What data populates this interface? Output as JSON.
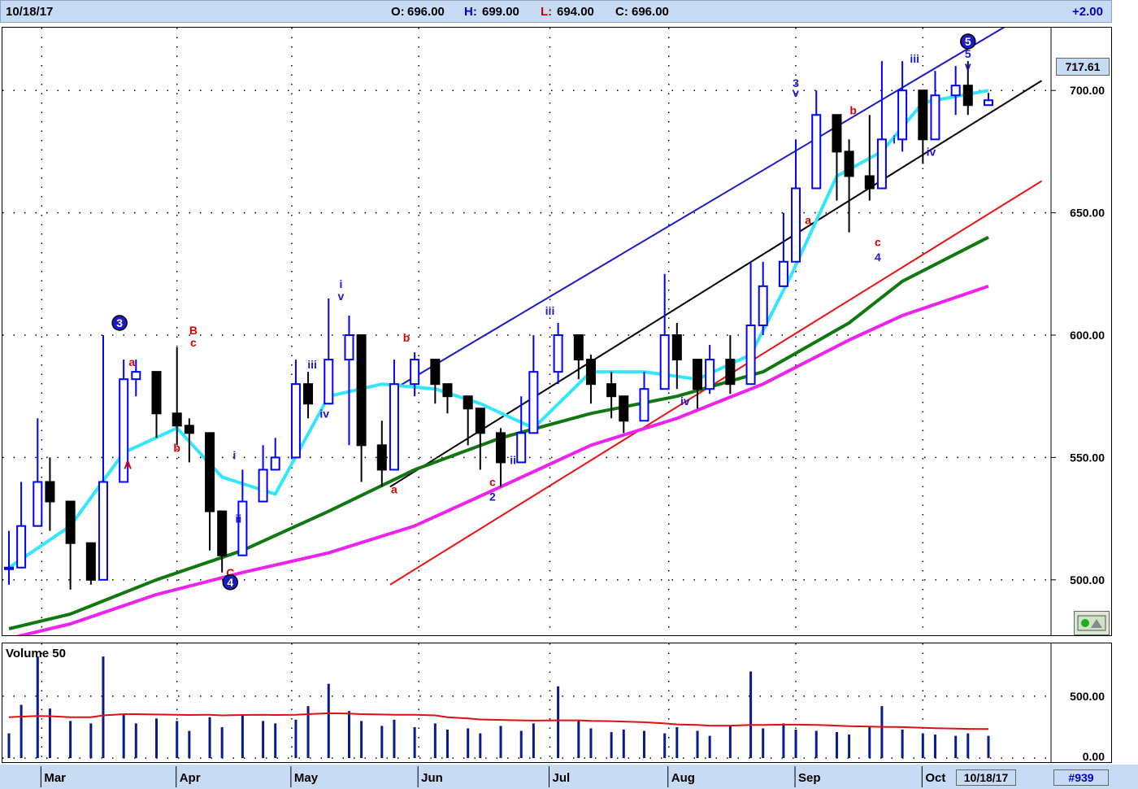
{
  "header": {
    "date": "10/18/17",
    "open_label": "O:",
    "open": "696.00",
    "high_label": "H:",
    "high": "699.00",
    "low_label": "L:",
    "low": "694.00",
    "close_label": "C:",
    "close": "696.00",
    "change": "+2.00"
  },
  "price_panel": {
    "last_price_label": "717.61",
    "y_ticks": [
      "700.00",
      "650.00",
      "600.00",
      "550.00",
      "500.00"
    ]
  },
  "volume_panel": {
    "title": "Volume 50",
    "y_ticks": [
      "500.00",
      "0.00"
    ]
  },
  "date_axis": {
    "months": [
      "Mar",
      "Apr",
      "May",
      "Jun",
      "Jul",
      "Aug",
      "Sep",
      "Oct"
    ],
    "current_date": "10/18/17",
    "symbol_count": "#939"
  },
  "colors": {
    "up_bar": "#0000ff",
    "down_bar": "#000000",
    "ma_short": "#33e6ff",
    "ma_mid": "#117711",
    "ma_long": "#ee22ee",
    "trend_blue": "#1a1acc",
    "trend_black": "#000000",
    "trend_red": "#ee1111",
    "volume_ma": "#dd1111",
    "volume_bars": "#0a1a8c"
  },
  "chart_data": {
    "type": "candlestick",
    "x_range": [
      "2017-02-21",
      "2017-10-18"
    ],
    "ylim": [
      478,
      725
    ],
    "grid": true,
    "price_bars": {
      "dates": [
        "2017-02-21",
        "2017-02-24",
        "2017-02-28",
        "2017-03-03",
        "2017-03-08",
        "2017-03-13",
        "2017-03-16",
        "2017-03-21",
        "2017-03-24",
        "2017-03-29",
        "2017-04-03",
        "2017-04-06",
        "2017-04-11",
        "2017-04-14",
        "2017-04-19",
        "2017-04-24",
        "2017-04-27",
        "2017-05-02",
        "2017-05-05",
        "2017-05-10",
        "2017-05-15",
        "2017-05-18",
        "2017-05-23",
        "2017-05-26",
        "2017-05-31",
        "2017-06-05",
        "2017-06-08",
        "2017-06-13",
        "2017-06-16",
        "2017-06-21",
        "2017-06-26",
        "2017-06-29",
        "2017-07-05",
        "2017-07-10",
        "2017-07-13",
        "2017-07-18",
        "2017-07-21",
        "2017-07-26",
        "2017-07-31",
        "2017-08-03",
        "2017-08-08",
        "2017-08-11",
        "2017-08-16",
        "2017-08-21",
        "2017-08-24",
        "2017-08-29",
        "2017-09-01",
        "2017-09-06",
        "2017-09-11",
        "2017-09-14",
        "2017-09-19",
        "2017-09-22",
        "2017-09-27",
        "2017-10-02",
        "2017-10-05",
        "2017-10-10",
        "2017-10-13",
        "2017-10-18"
      ],
      "close": [
        505,
        522,
        540,
        532,
        515,
        500,
        540,
        582,
        585,
        568,
        563,
        560,
        528,
        510,
        532,
        545,
        550,
        580,
        572,
        590,
        600,
        555,
        545,
        580,
        590,
        580,
        575,
        570,
        560,
        548,
        560,
        585,
        600,
        590,
        580,
        575,
        565,
        578,
        600,
        590,
        578,
        590,
        580,
        604,
        620,
        630,
        660,
        690,
        675,
        665,
        660,
        680,
        700,
        680,
        698,
        702,
        694,
        696
      ],
      "high": [
        520,
        540,
        566,
        550,
        522,
        510,
        600,
        590,
        590,
        582,
        595,
        566,
        540,
        520,
        545,
        555,
        558,
        590,
        585,
        615,
        608,
        572,
        565,
        590,
        593,
        585,
        580,
        575,
        565,
        562,
        575,
        600,
        605,
        598,
        592,
        585,
        572,
        585,
        625,
        605,
        590,
        596,
        600,
        630,
        630,
        650,
        680,
        700,
        688,
        680,
        690,
        712,
        712,
        690,
        708,
        710,
        712,
        699
      ],
      "low": [
        498,
        512,
        530,
        520,
        496,
        498,
        530,
        552,
        575,
        558,
        555,
        548,
        512,
        503,
        520,
        535,
        545,
        568,
        566,
        580,
        555,
        540,
        538,
        570,
        575,
        572,
        568,
        555,
        545,
        538,
        555,
        578,
        580,
        582,
        572,
        566,
        560,
        572,
        585,
        578,
        570,
        576,
        576,
        590,
        600,
        620,
        640,
        670,
        655,
        642,
        655,
        660,
        675,
        670,
        688,
        690,
        690,
        694
      ]
    },
    "moving_averages": [
      {
        "dates": [
          "2017-02-21",
          "2017-03-08",
          "2017-03-21",
          "2017-04-03",
          "2017-04-14",
          "2017-04-27",
          "2017-05-10",
          "2017-05-23",
          "2017-06-05",
          "2017-06-16",
          "2017-06-29",
          "2017-07-13",
          "2017-07-26",
          "2017-08-08",
          "2017-08-21",
          "2017-08-31",
          "2017-09-11",
          "2017-09-22",
          "2017-10-02",
          "2017-10-18"
        ],
        "values": [
          505,
          522,
          552,
          562,
          542,
          535,
          575,
          580,
          578,
          572,
          562,
          585,
          585,
          582,
          592,
          625,
          665,
          675,
          695,
          700
        ]
      },
      {
        "dates": [
          "2017-02-21",
          "2017-03-08",
          "2017-03-29",
          "2017-04-19",
          "2017-05-10",
          "2017-05-31",
          "2017-06-21",
          "2017-07-13",
          "2017-08-03",
          "2017-08-24",
          "2017-09-14",
          "2017-09-27",
          "2017-10-18"
        ],
        "values": [
          480,
          486,
          500,
          512,
          528,
          545,
          558,
          568,
          575,
          585,
          605,
          622,
          640
        ]
      },
      {
        "dates": [
          "2017-02-21",
          "2017-03-08",
          "2017-03-29",
          "2017-04-19",
          "2017-05-10",
          "2017-05-31",
          "2017-06-21",
          "2017-07-13",
          "2017-08-03",
          "2017-08-24",
          "2017-09-14",
          "2017-09-27",
          "2017-10-18"
        ],
        "values": [
          476,
          482,
          494,
          503,
          511,
          522,
          538,
          555,
          566,
          580,
          598,
          608,
          620
        ]
      }
    ],
    "trend_lines": [
      {
        "from": [
          "2017-05-25",
          577
        ],
        "to": [
          "2017-10-23",
          727
        ]
      },
      {
        "from": [
          "2017-05-25",
          538
        ],
        "to": [
          "2017-10-31",
          704
        ]
      },
      {
        "from": [
          "2017-05-25",
          498
        ],
        "to": [
          "2017-10-31",
          663
        ]
      }
    ],
    "wave_labels": [
      {
        "date": "2017-03-20",
        "value": 605,
        "text": "3",
        "style": "circle"
      },
      {
        "date": "2017-03-23",
        "value": 589,
        "text": "a",
        "style": "red"
      },
      {
        "date": "2017-03-22",
        "value": 547,
        "text": "A",
        "style": "red"
      },
      {
        "date": "2017-04-07",
        "value": 602,
        "text": "B",
        "style": "red"
      },
      {
        "date": "2017-04-07",
        "value": 597,
        "text": "c",
        "style": "red"
      },
      {
        "date": "2017-04-03",
        "value": 554,
        "text": "b",
        "style": "red"
      },
      {
        "date": "2017-04-16",
        "value": 503,
        "text": "C",
        "style": "red"
      },
      {
        "date": "2017-04-16",
        "value": 499,
        "text": "4",
        "style": "circle"
      },
      {
        "date": "2017-04-18",
        "value": 525,
        "text": "ii",
        "style": "blue"
      },
      {
        "date": "2017-04-17",
        "value": 551,
        "text": "i",
        "style": "blue"
      },
      {
        "date": "2017-05-06",
        "value": 588,
        "text": "iii",
        "style": "blue"
      },
      {
        "date": "2017-05-09",
        "value": 568,
        "text": "iv",
        "style": "blue"
      },
      {
        "date": "2017-05-13",
        "value": 621,
        "text": "i",
        "style": "blue"
      },
      {
        "date": "2017-05-13",
        "value": 616,
        "text": "v",
        "style": "blue"
      },
      {
        "date": "2017-05-29",
        "value": 599,
        "text": "b",
        "style": "red"
      },
      {
        "date": "2017-05-26",
        "value": 537,
        "text": "a",
        "style": "red"
      },
      {
        "date": "2017-06-19",
        "value": 540,
        "text": "c",
        "style": "red"
      },
      {
        "date": "2017-06-19",
        "value": 534,
        "text": "2",
        "style": "blue"
      },
      {
        "date": "2017-06-24",
        "value": 549,
        "text": "ii",
        "style": "blue"
      },
      {
        "date": "2017-07-03",
        "value": 610,
        "text": "iii",
        "style": "blue"
      },
      {
        "date": "2017-08-05",
        "value": 573,
        "text": "iv",
        "style": "blue"
      },
      {
        "date": "2017-09-01",
        "value": 703,
        "text": "3",
        "style": "blue"
      },
      {
        "date": "2017-09-01",
        "value": 699,
        "text": "v",
        "style": "blue"
      },
      {
        "date": "2017-09-04",
        "value": 647,
        "text": "a",
        "style": "red"
      },
      {
        "date": "2017-09-15",
        "value": 692,
        "text": "b",
        "style": "red"
      },
      {
        "date": "2017-09-21",
        "value": 638,
        "text": "c",
        "style": "red"
      },
      {
        "date": "2017-09-21",
        "value": 632,
        "text": "4",
        "style": "blue"
      },
      {
        "date": "2017-09-25",
        "value": 680,
        "text": "i",
        "style": "blue"
      },
      {
        "date": "2017-09-30",
        "value": 713,
        "text": "iii",
        "style": "blue"
      },
      {
        "date": "2017-10-04",
        "value": 675,
        "text": "iv",
        "style": "blue"
      },
      {
        "date": "2017-10-13",
        "value": 720,
        "text": "5",
        "style": "circle"
      },
      {
        "date": "2017-10-13",
        "value": 715,
        "text": "5",
        "style": "blue"
      },
      {
        "date": "2017-10-13",
        "value": 710,
        "text": "v",
        "style": "blue"
      }
    ],
    "volume": {
      "ylim": [
        0,
        900
      ],
      "dates": [
        "2017-02-21",
        "2017-02-24",
        "2017-02-28",
        "2017-03-03",
        "2017-03-08",
        "2017-03-13",
        "2017-03-16",
        "2017-03-21",
        "2017-03-24",
        "2017-03-29",
        "2017-04-03",
        "2017-04-06",
        "2017-04-11",
        "2017-04-14",
        "2017-04-19",
        "2017-04-24",
        "2017-04-27",
        "2017-05-02",
        "2017-05-05",
        "2017-05-10",
        "2017-05-15",
        "2017-05-18",
        "2017-05-23",
        "2017-05-26",
        "2017-05-31",
        "2017-06-05",
        "2017-06-08",
        "2017-06-13",
        "2017-06-16",
        "2017-06-21",
        "2017-06-26",
        "2017-06-29",
        "2017-07-05",
        "2017-07-10",
        "2017-07-13",
        "2017-07-18",
        "2017-07-21",
        "2017-07-26",
        "2017-07-31",
        "2017-08-03",
        "2017-08-08",
        "2017-08-11",
        "2017-08-16",
        "2017-08-21",
        "2017-08-24",
        "2017-08-29",
        "2017-09-01",
        "2017-09-06",
        "2017-09-11",
        "2017-09-14",
        "2017-09-19",
        "2017-09-22",
        "2017-09-27",
        "2017-10-02",
        "2017-10-05",
        "2017-10-10",
        "2017-10-13",
        "2017-10-18"
      ],
      "values": [
        200,
        430,
        820,
        400,
        300,
        280,
        820,
        350,
        280,
        320,
        300,
        220,
        330,
        250,
        350,
        300,
        280,
        310,
        420,
        600,
        380,
        300,
        260,
        310,
        250,
        280,
        230,
        240,
        200,
        260,
        220,
        280,
        580,
        300,
        240,
        210,
        230,
        220,
        200,
        250,
        220,
        180,
        260,
        700,
        240,
        280,
        230,
        220,
        210,
        190,
        260,
        420,
        230,
        200,
        190,
        180,
        200,
        180
      ],
      "ma_values": [
        330,
        335,
        340,
        338,
        330,
        330,
        345,
        355,
        355,
        352,
        350,
        348,
        350,
        345,
        348,
        350,
        348,
        350,
        355,
        362,
        360,
        355,
        352,
        350,
        350,
        345,
        330,
        320,
        312,
        308,
        305,
        303,
        305,
        305,
        300,
        298,
        295,
        290,
        280,
        272,
        268,
        262,
        262,
        268,
        268,
        270,
        270,
        268,
        262,
        258,
        255,
        252,
        250,
        245,
        242,
        238,
        236,
        235
      ]
    }
  }
}
